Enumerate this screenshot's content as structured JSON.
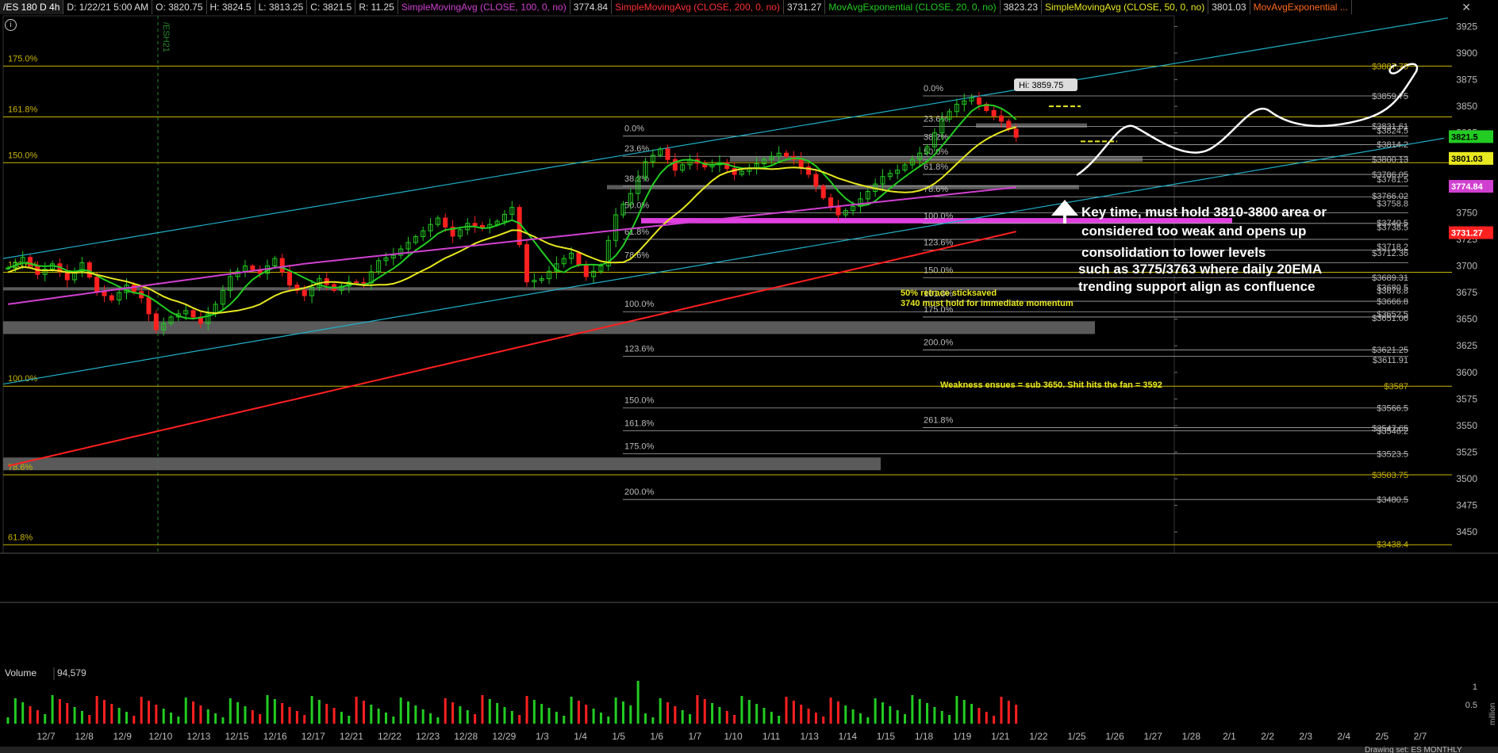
{
  "header": {
    "symbol": "/ES 180 D 4h",
    "date": "D: 1/22/21 5:00 AM",
    "open": "O: 3820.75",
    "high": "H: 3824.5",
    "low": "L: 3813.25",
    "close": "C: 3821.5",
    "range": "R: 11.25",
    "studies": [
      {
        "label": "SimpleMovingAvg (CLOSE, 100, 0, no)",
        "value": "3774.84",
        "color": "#d040d0"
      },
      {
        "label": "SimpleMovingAvg (CLOSE, 200, 0, no)",
        "value": "3731.27",
        "color": "#ff3030"
      },
      {
        "label": "MovAvgExponential (CLOSE, 20, 0, no)",
        "value": "3823.23",
        "color": "#22cc22"
      },
      {
        "label": "SimpleMovingAvg (CLOSE, 50, 0, no)",
        "value": "3801.03",
        "color": "#e8e820"
      },
      {
        "label": "MovAvgExponential ...",
        "value": "",
        "color": "#ff6a1a"
      }
    ]
  },
  "icons": {
    "info": "info-icon",
    "close": "close-icon",
    "expand": "expand-icon",
    "draw": "drawing-icon"
  },
  "colors": {
    "up": "#22cc22",
    "down": "#ff2020",
    "grid": "#2a2a2a",
    "fib": "#c8b400",
    "channel": "#1fb0c8"
  },
  "footer": {
    "drawing_set": "Drawing set: ES MONTHLY"
  },
  "chart_data": {
    "type": "candlestick",
    "ylim": [
      3430,
      3935
    ],
    "y_ticks": [
      3450,
      3475,
      3500,
      3525,
      3550,
      3575,
      3600,
      3625,
      3650,
      3675,
      3700,
      3725,
      3750,
      3775,
      3800,
      3825,
      3850,
      3875,
      3900,
      3925
    ],
    "x_labels": [
      "12/7",
      "12/8",
      "12/9",
      "12/10",
      "12/13",
      "12/15",
      "12/16",
      "12/17",
      "12/21",
      "12/22",
      "12/23",
      "12/28",
      "12/29",
      "1/3",
      "1/4",
      "1/5",
      "1/6",
      "1/7",
      "1/10",
      "1/11",
      "1/13",
      "1/14",
      "1/15",
      "1/18",
      "1/19",
      "1/21",
      "1/22",
      "1/25",
      "1/26",
      "1/27",
      "1/28",
      "2/1",
      "2/2",
      "2/3",
      "2/4",
      "2/5",
      "2/7"
    ],
    "price_points": [
      [
        0,
        3698
      ],
      [
        2,
        3708
      ],
      [
        4,
        3692
      ],
      [
        6,
        3702
      ],
      [
        8,
        3687
      ],
      [
        10,
        3703
      ],
      [
        12,
        3676
      ],
      [
        14,
        3668
      ],
      [
        16,
        3682
      ],
      [
        18,
        3670
      ],
      [
        20,
        3640
      ],
      [
        22,
        3652
      ],
      [
        24,
        3658
      ],
      [
        26,
        3646
      ],
      [
        28,
        3664
      ],
      [
        30,
        3690
      ],
      [
        32,
        3700
      ],
      [
        34,
        3693
      ],
      [
        36,
        3707
      ],
      [
        38,
        3682
      ],
      [
        40,
        3672
      ],
      [
        42,
        3688
      ],
      [
        44,
        3677
      ],
      [
        46,
        3685
      ],
      [
        48,
        3684
      ],
      [
        50,
        3705
      ],
      [
        52,
        3710
      ],
      [
        54,
        3722
      ],
      [
        56,
        3733
      ],
      [
        58,
        3745
      ],
      [
        60,
        3728
      ],
      [
        62,
        3740
      ],
      [
        64,
        3736
      ],
      [
        66,
        3742
      ],
      [
        68,
        3755
      ],
      [
        70,
        3685
      ],
      [
        72,
        3688
      ],
      [
        74,
        3702
      ],
      [
        76,
        3712
      ],
      [
        78,
        3690
      ],
      [
        80,
        3700
      ],
      [
        82,
        3748
      ],
      [
        84,
        3768
      ],
      [
        86,
        3798
      ],
      [
        88,
        3810
      ],
      [
        90,
        3790
      ],
      [
        92,
        3800
      ],
      [
        94,
        3793
      ],
      [
        96,
        3797
      ],
      [
        98,
        3786
      ],
      [
        100,
        3792
      ],
      [
        102,
        3800
      ],
      [
        104,
        3806
      ],
      [
        106,
        3800
      ],
      [
        108,
        3786
      ],
      [
        110,
        3764
      ],
      [
        112,
        3748
      ],
      [
        114,
        3756
      ],
      [
        116,
        3770
      ],
      [
        118,
        3784
      ],
      [
        120,
        3790
      ],
      [
        122,
        3800
      ],
      [
        124,
        3812
      ],
      [
        126,
        3838
      ],
      [
        128,
        3852
      ],
      [
        130,
        3858
      ],
      [
        132,
        3846
      ],
      [
        134,
        3836
      ],
      [
        136,
        3821
      ]
    ],
    "candle_slots": 137,
    "hi_label": "Hi: 3859.75",
    "right_labels": [
      {
        "y": 3887.75,
        "text": "$3887.75",
        "color": "#c8b400"
      },
      {
        "y": 3859.75,
        "text": "$3859.75",
        "color": "#bbbbbb"
      },
      {
        "y": 3831.61,
        "text": "$3831.61",
        "color": "#bbbbbb"
      },
      {
        "y": 3827.5,
        "text": "$3824.5",
        "color": "#bbbbbb"
      },
      {
        "y": 3814.2,
        "text": "$3814.2",
        "color": "#bbbbbb"
      },
      {
        "y": 3800.13,
        "text": "$3800.13",
        "color": "#bbbbbb"
      },
      {
        "y": 3786.05,
        "text": "$3786.05",
        "color": "#bbbbbb"
      },
      {
        "y": 3781.5,
        "text": "$3781.5",
        "color": "#bbbbbb"
      },
      {
        "y": 3766.02,
        "text": "$3766.02",
        "color": "#bbbbbb"
      },
      {
        "y": 3758.8,
        "text": "$3758.8",
        "color": "#bbbbbb"
      },
      {
        "y": 3740.5,
        "text": "$3740.5",
        "color": "#bbbbbb"
      },
      {
        "y": 3736.5,
        "text": "$3738.5",
        "color": "#bbbbbb"
      },
      {
        "y": 3718.2,
        "text": "$3718.2",
        "color": "#bbbbbb"
      },
      {
        "y": 3712.36,
        "text": "$3712.36",
        "color": "#bbbbbb"
      },
      {
        "y": 3689.31,
        "text": "$3689.31",
        "color": "#bbbbbb"
      },
      {
        "y": 3680,
        "text": "$3680.5",
        "color": "#bbbbbb"
      },
      {
        "y": 3676.8,
        "text": "$3678.8",
        "color": "#bbbbbb"
      },
      {
        "y": 3666.8,
        "text": "$3666.8",
        "color": "#bbbbbb"
      },
      {
        "y": 3655,
        "text": "$3652.5",
        "color": "#bbbbbb"
      },
      {
        "y": 3651.06,
        "text": "$3651.06",
        "color": "#bbbbbb"
      },
      {
        "y": 3621.25,
        "text": "$3621.25",
        "color": "#bbbbbb"
      },
      {
        "y": 3611.91,
        "text": "$3611.91",
        "color": "#bbbbbb"
      },
      {
        "y": 3587,
        "text": "$3587",
        "color": "#c8b400"
      },
      {
        "y": 3566.5,
        "text": "$3566.5",
        "color": "#bbbbbb"
      },
      {
        "y": 3547.65,
        "text": "$3547.65",
        "color": "#bbbbbb"
      },
      {
        "y": 3545,
        "text": "$3546.2",
        "color": "#bbbbbb"
      },
      {
        "y": 3523.5,
        "text": "$3523.5",
        "color": "#bbbbbb"
      },
      {
        "y": 3503.75,
        "text": "$3503.75",
        "color": "#c8b400"
      },
      {
        "y": 3480.5,
        "text": "$3480.5",
        "color": "#bbbbbb"
      },
      {
        "y": 3438.4,
        "text": "$3438.4",
        "color": "#c8b400"
      }
    ],
    "price_tags": [
      {
        "y": 3821.5,
        "text": "3821.5",
        "bg": "#22cc22",
        "fg": "#000"
      },
      {
        "y": 3801.03,
        "text": "3801.03",
        "bg": "#e8e820",
        "fg": "#000"
      },
      {
        "y": 3774.84,
        "text": "3774.84",
        "bg": "#d040d0",
        "fg": "#fff"
      },
      {
        "y": 3731.27,
        "text": "3731.27",
        "bg": "#ff2020",
        "fg": "#fff"
      }
    ],
    "fib_long": [
      {
        "y": 3887.75,
        "text": "175.0%"
      },
      {
        "y": 3840,
        "text": "161.8%"
      },
      {
        "y": 3797,
        "text": "150.0%"
      },
      {
        "y": 3694,
        "text": "123.6%"
      },
      {
        "y": 3587,
        "text": "100.0%"
      },
      {
        "y": 3503.75,
        "text": "78.6%"
      },
      {
        "y": 3438,
        "text": "61.8%"
      }
    ],
    "fib_mid": [
      {
        "y": 3822,
        "text": "0.0%"
      },
      {
        "y": 3803,
        "text": "23.6%"
      },
      {
        "y": 3775,
        "text": "38.2%"
      },
      {
        "y": 3750,
        "text": "50.0%"
      },
      {
        "y": 3725,
        "text": "61.8%"
      },
      {
        "y": 3703,
        "text": "78.6%"
      },
      {
        "y": 3657,
        "text": "100.0%"
      },
      {
        "y": 3615,
        "text": "123.6%"
      },
      {
        "y": 3566.5,
        "text": "150.0%"
      },
      {
        "y": 3545,
        "text": "161.8%"
      },
      {
        "y": 3523.5,
        "text": "175.0%"
      },
      {
        "y": 3480.5,
        "text": "200.0%"
      }
    ],
    "fib_recent": [
      {
        "y": 3859.75,
        "text": "0.0%"
      },
      {
        "y": 3831,
        "text": "23.6%"
      },
      {
        "y": 3814,
        "text": "38.2%"
      },
      {
        "y": 3800,
        "text": "50.0%"
      },
      {
        "y": 3786,
        "text": "61.8%"
      },
      {
        "y": 3765,
        "text": "78.6%"
      },
      {
        "y": 3740,
        "text": "100.0%"
      },
      {
        "y": 3715,
        "text": "123.6%"
      },
      {
        "y": 3689,
        "text": "150.0%"
      },
      {
        "y": 3666.8,
        "text": "161.8%"
      },
      {
        "y": 3652,
        "text": "175.0%"
      },
      {
        "y": 3621,
        "text": "200.0%"
      },
      {
        "y": 3548,
        "text": "261.8%"
      }
    ],
    "notes": {
      "white": [
        "Key time, must hold 3810-3800 area or",
        "considered too weak and opens up",
        "consolidation to lower levels",
        "such as 3775/3763 where daily 20EMA",
        "trending support align as confluence"
      ],
      "yellow": [
        "50% retrace sticksaved",
        "3740 must hold for immediate momentum",
        "Weakness ensues = sub 3650. Shit hits the fan = 3592"
      ]
    },
    "contract_label": "/ESH21",
    "volume": {
      "label": "Volume",
      "value": "94,579",
      "scale_max": "1",
      "scale_mid": "0.5",
      "unit": "million"
    }
  }
}
